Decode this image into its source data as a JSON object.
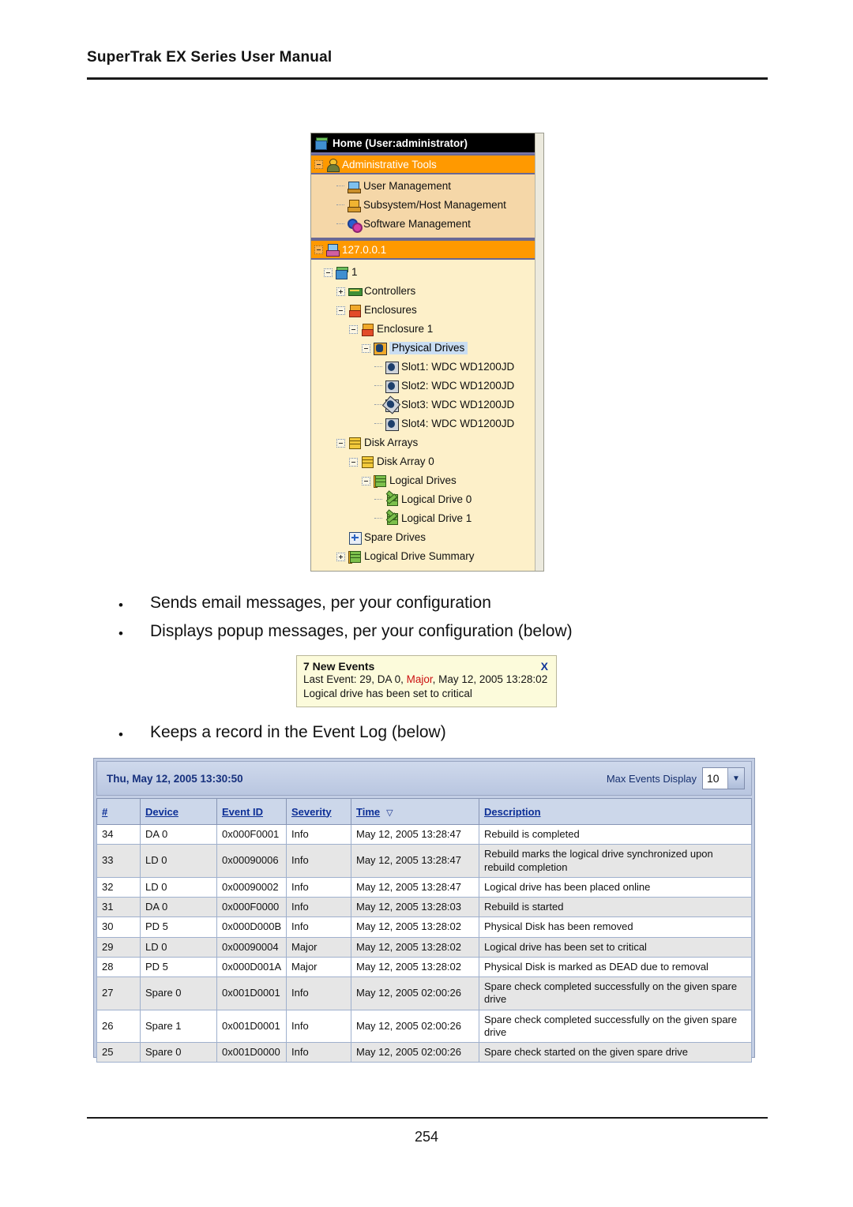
{
  "document": {
    "header_title": "SuperTrak EX Series User Manual",
    "page_number": "254"
  },
  "bullets": {
    "marker": "•",
    "email": "Sends email messages, per your configuration",
    "popup": "Displays popup messages, per your configuration (below)",
    "eventlog": "Keeps a record in the Event Log (below)"
  },
  "tree_panel": {
    "title": "Home (User:administrator)",
    "title_icon": "home-icon",
    "scrollbar": "vertical-scrollbar",
    "nodes": [
      {
        "label": "Administrative Tools",
        "icon": "admin-user-icon",
        "style": "band-orange",
        "expander": "minus",
        "indent": 0
      },
      {
        "label": "User Management",
        "icon": "user-management-icon",
        "style": "tan",
        "expander": "none",
        "indent": 2
      },
      {
        "label": "Subsystem/Host Management",
        "icon": "subsystem-host-icon",
        "style": "tan",
        "expander": "none",
        "indent": 2
      },
      {
        "label": "Software Management",
        "icon": "gears-icon",
        "style": "tan",
        "expander": "none",
        "indent": 2
      },
      {
        "label": "127.0.0.1",
        "icon": "host-icon",
        "style": "band-orange",
        "expander": "minus",
        "indent": 0
      },
      {
        "label": "1",
        "icon": "server-icon",
        "style": "plain",
        "expander": "minus",
        "indent": 1
      },
      {
        "label": "Controllers",
        "icon": "controller-icon",
        "style": "plain",
        "expander": "plus",
        "indent": 2
      },
      {
        "label": "Enclosures",
        "icon": "enclosure-icon",
        "style": "plain",
        "expander": "minus",
        "indent": 2
      },
      {
        "label": "Enclosure 1",
        "icon": "enclosure-icon",
        "style": "plain",
        "expander": "minus",
        "indent": 3
      },
      {
        "label": "Physical Drives",
        "icon": "physical-drives-folder-icon",
        "style": "selected",
        "expander": "minus",
        "indent": 4
      },
      {
        "label": "Slot1: WDC WD1200JD",
        "icon": "physical-drive-icon",
        "style": "plain",
        "expander": "none",
        "indent": 5
      },
      {
        "label": "Slot2: WDC WD1200JD",
        "icon": "physical-drive-icon",
        "style": "plain",
        "expander": "none",
        "indent": 5
      },
      {
        "label": "Slot3: WDC WD1200JD",
        "icon": "physical-drive-error-icon",
        "style": "plain",
        "expander": "none",
        "indent": 5
      },
      {
        "label": "Slot4: WDC WD1200JD",
        "icon": "physical-drive-icon",
        "style": "plain",
        "expander": "none",
        "indent": 5
      },
      {
        "label": "Disk Arrays",
        "icon": "disk-arrays-icon",
        "style": "plain",
        "expander": "minus",
        "indent": 2
      },
      {
        "label": "Disk Array 0",
        "icon": "disk-array-icon",
        "style": "plain",
        "expander": "minus",
        "indent": 3
      },
      {
        "label": "Logical Drives",
        "icon": "logical-drives-icon",
        "style": "plain",
        "expander": "minus",
        "indent": 4
      },
      {
        "label": "Logical Drive 0",
        "icon": "logical-drive-error-icon",
        "style": "plain",
        "expander": "none",
        "indent": 5
      },
      {
        "label": "Logical Drive 1",
        "icon": "logical-drive-error-icon",
        "style": "plain",
        "expander": "none",
        "indent": 5
      },
      {
        "label": "Spare Drives",
        "icon": "spare-drives-icon",
        "style": "plain",
        "expander": "none",
        "indent": 2
      },
      {
        "label": "Logical Drive Summary",
        "icon": "logical-drive-summary-icon",
        "style": "plain",
        "expander": "plus",
        "indent": 2
      }
    ]
  },
  "toast": {
    "title": "7 New Events",
    "close_label": "X",
    "line1_prefix": "Last Event: 29, DA 0, ",
    "line1_severity": "Major",
    "line1_suffix": ", May 12, 2005 13:28:02",
    "line2": "Logical drive has been set to critical"
  },
  "event_log": {
    "timestamp": "Thu, May 12, 2005 13:30:50",
    "max_events_label": "Max Events Display",
    "max_events_value": "10",
    "dropdown_icon": "chevron-down-icon",
    "columns": [
      "#",
      "Device",
      "Event ID",
      "Severity",
      "Time",
      "Description"
    ],
    "sort_column": "Time",
    "sort_marker": "▽",
    "rows": [
      {
        "num": "34",
        "device": "DA 0",
        "event_id": "0x000F0001",
        "severity": "Info",
        "time": "May 12, 2005 13:28:47",
        "description": "Rebuild is completed"
      },
      {
        "num": "33",
        "device": "LD 0",
        "event_id": "0x00090006",
        "severity": "Info",
        "time": "May 12, 2005 13:28:47",
        "description": "Rebuild marks the logical drive synchronized upon rebuild completion"
      },
      {
        "num": "32",
        "device": "LD 0",
        "event_id": "0x00090002",
        "severity": "Info",
        "time": "May 12, 2005 13:28:47",
        "description": "Logical drive has been placed online"
      },
      {
        "num": "31",
        "device": "DA 0",
        "event_id": "0x000F0000",
        "severity": "Info",
        "time": "May 12, 2005 13:28:03",
        "description": "Rebuild is started"
      },
      {
        "num": "30",
        "device": "PD 5",
        "event_id": "0x000D000B",
        "severity": "Info",
        "time": "May 12, 2005 13:28:02",
        "description": "Physical Disk has been removed"
      },
      {
        "num": "29",
        "device": "LD 0",
        "event_id": "0x00090004",
        "severity": "Major",
        "time": "May 12, 2005 13:28:02",
        "description": "Logical drive has been set to critical"
      },
      {
        "num": "28",
        "device": "PD 5",
        "event_id": "0x000D001A",
        "severity": "Major",
        "time": "May 12, 2005 13:28:02",
        "description": "Physical Disk is marked as DEAD due to removal"
      },
      {
        "num": "27",
        "device": "Spare 0",
        "event_id": "0x001D0001",
        "severity": "Info",
        "time": "May 12, 2005 02:00:26",
        "description": "Spare check completed successfully on the given spare drive"
      },
      {
        "num": "26",
        "device": "Spare 1",
        "event_id": "0x001D0001",
        "severity": "Info",
        "time": "May 12, 2005 02:00:26",
        "description": "Spare check completed successfully on the given spare drive"
      },
      {
        "num": "25",
        "device": "Spare 0",
        "event_id": "0x001D0000",
        "severity": "Info",
        "time": "May 12, 2005 02:00:26",
        "description": "Spare check started on the given spare drive"
      }
    ]
  },
  "colors": {
    "accent_orange": "#ff9900",
    "tan": "#f5d7a8",
    "tree_bg": "#fdf0c9",
    "severity_major": "#cc1111",
    "header_blue": "#0d2f96",
    "toast_bg": "#fcfbdb"
  }
}
